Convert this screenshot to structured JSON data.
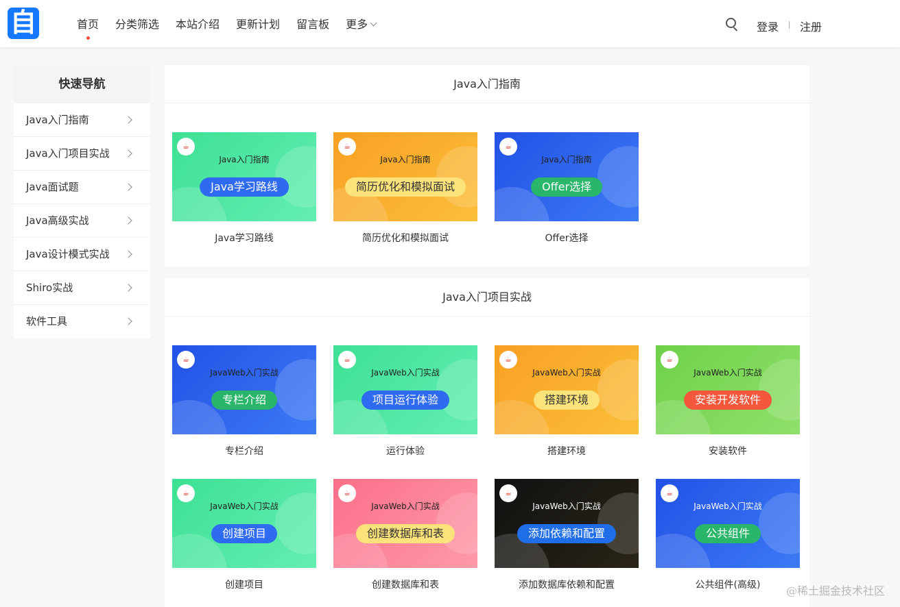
{
  "header": {
    "logo_char": "自",
    "nav": [
      "首页",
      "分类筛选",
      "本站介绍",
      "更新计划",
      "留言板",
      "更多"
    ],
    "login": "登录",
    "register": "注册"
  },
  "sidebar": {
    "title": "快速导航",
    "items": [
      "Java入门指南",
      "Java入门项目实战",
      "Java面试题",
      "Java高级实战",
      "Java设计模式实战",
      "Shiro实战",
      "软件工具"
    ]
  },
  "sections": [
    {
      "title": "Java入门指南",
      "cards": [
        {
          "sub": "Java入门指南",
          "pill": "Java学习路线",
          "caption": "Java学习路线",
          "bg": "#3ee095",
          "bg2": "#63eeb1",
          "pill_bg": "#2f6bf0",
          "pill_fg": "#ffffff"
        },
        {
          "sub": "Java入门指南",
          "pill": "简历优化和模拟面试",
          "caption": "简历优化和模拟面试",
          "bg": "#f9a023",
          "bg2": "#fbbf3a",
          "pill_bg": "#fbe27a",
          "pill_fg": "#333333"
        },
        {
          "sub": "Java入门指南",
          "pill": "Offer选择",
          "caption": "Offer选择",
          "bg": "#2252e6",
          "bg2": "#3c7af5",
          "pill_bg": "#2ab66a",
          "pill_fg": "#ffffff"
        }
      ]
    },
    {
      "title": "Java入门项目实战",
      "cards": [
        {
          "sub": "JavaWeb入门实战",
          "pill": "专栏介绍",
          "caption": "专栏介绍",
          "bg": "#2252e6",
          "bg2": "#3c7af5",
          "pill_bg": "#2ab66a",
          "pill_fg": "#ffffff"
        },
        {
          "sub": "JavaWeb入门实战",
          "pill": "项目运行体验",
          "caption": "运行体验",
          "bg": "#3ee095",
          "bg2": "#63eeb1",
          "pill_bg": "#2f6bf0",
          "pill_fg": "#ffffff"
        },
        {
          "sub": "JavaWeb入门实战",
          "pill": "搭建环境",
          "caption": "搭建环境",
          "bg": "#f9a023",
          "bg2": "#fbbf3a",
          "pill_bg": "#fbe27a",
          "pill_fg": "#333333"
        },
        {
          "sub": "JavaWeb入门实战",
          "pill": "安装开发软件",
          "caption": "安装软件",
          "bg": "#6fd14a",
          "bg2": "#8fe06a",
          "pill_bg": "#f4573b",
          "pill_fg": "#ffffff"
        },
        {
          "sub": "JavaWeb入门实战",
          "pill": "创建项目",
          "caption": "创建项目",
          "bg": "#3ee095",
          "bg2": "#63eeb1",
          "pill_bg": "#2f6bf0",
          "pill_fg": "#ffffff"
        },
        {
          "sub": "JavaWeb入门实战",
          "pill": "创建数据库和表",
          "caption": "创建数据库和表",
          "bg": "#fb6f8a",
          "bg2": "#fd9aa8",
          "pill_bg": "#fbe27a",
          "pill_fg": "#333333"
        },
        {
          "sub": "JavaWeb入门实战",
          "pill": "添加依赖和配置",
          "caption": "添加数据库依赖和配置",
          "bg": "#111111",
          "bg2": "#2a2418",
          "pill_bg": "#1f6ee8",
          "pill_fg": "#ffffff",
          "sub_fg": "#ffffff"
        },
        {
          "sub": "JavaWeb入门实战",
          "pill": "公共组件",
          "caption": "公共组件(高级)",
          "bg": "#2252e6",
          "bg2": "#3c7af5",
          "pill_bg": "#2ab66a",
          "pill_fg": "#ffffff",
          "sub_fg": "#ffffff"
        }
      ]
    }
  ],
  "watermark": "@稀土掘金技术社区"
}
